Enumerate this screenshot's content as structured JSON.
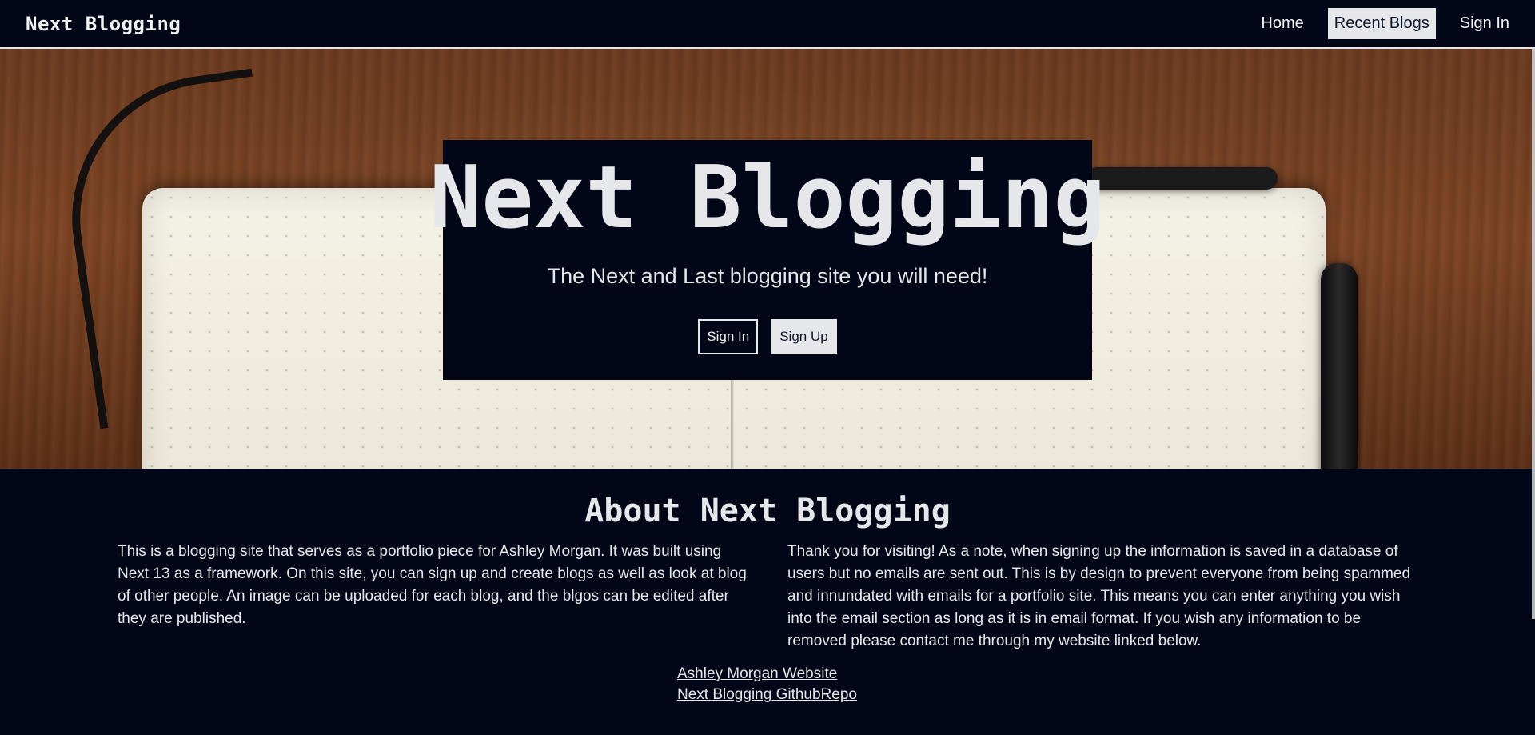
{
  "navbar": {
    "brand": "Next Blogging",
    "links": [
      {
        "label": "Home"
      },
      {
        "label": "Recent Blogs"
      },
      {
        "label": "Sign In"
      }
    ]
  },
  "hero": {
    "title": "Next Blogging",
    "subtitle": "The Next and Last blogging site you will need!",
    "buttons": {
      "sign_in": "Sign In",
      "sign_up": "Sign Up"
    }
  },
  "about": {
    "title": "About Next Blogging",
    "left_paragraph": "This is a blogging site that serves as a portfolio piece for Ashley Morgan. It was built using Next 13 as a framework. On this site, you can sign up and create blogs as well as look at blog of other people. An image can be uploaded for each blog, and the blgos can be edited after they are published.",
    "right_paragraph": "Thank you for visiting! As a note, when signing up the information is saved in a database of users but no emails are sent out. This is by design to prevent everyone from being spammed and innundated with emails for a portfolio site. This means you can enter anything you wish into the email section as long as it is in email format. If you wish any information to be removed please contact me through my website linked below.",
    "links": [
      {
        "label": "Ashley Morgan Website"
      },
      {
        "label": "Next Blogging GithubRepo"
      }
    ]
  },
  "colors": {
    "background": "#020617",
    "text": "#e5e7eb",
    "accent": "#e5e7eb"
  }
}
